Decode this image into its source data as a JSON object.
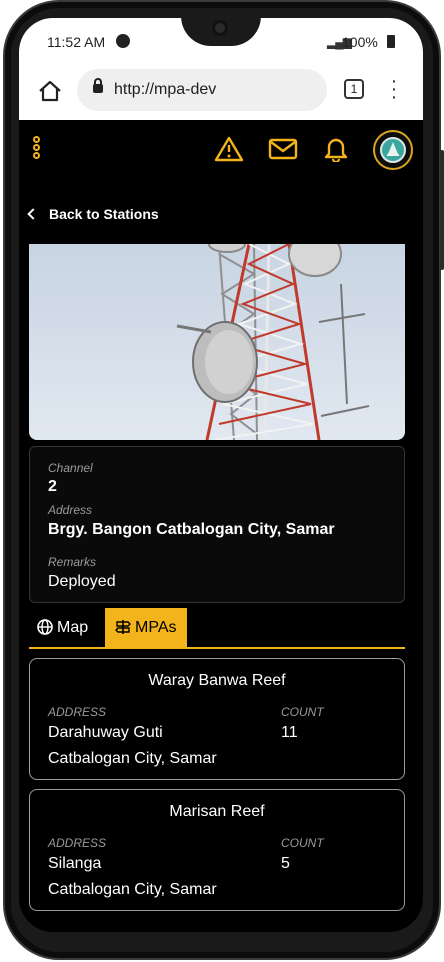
{
  "status_bar": {
    "time": "11:52 AM",
    "battery": "100%"
  },
  "browser": {
    "url": "http://mpa-dev",
    "tab_count": "1"
  },
  "nav": {
    "back_label": "Back to Stations"
  },
  "station": {
    "channel_label": "Channel",
    "channel_value": "2",
    "address_label": "Address",
    "address_value": "Brgy. Bangon Catbalogan City, Samar",
    "remarks_label": "Remarks",
    "remarks_value": "Deployed"
  },
  "tabs": [
    {
      "label": "Map",
      "icon": "globe-icon",
      "active": false
    },
    {
      "label": "MPAs",
      "icon": "signpost-icon",
      "active": true
    }
  ],
  "mpas": [
    {
      "name": "Waray Banwa Reef",
      "address_label": "ADDRESS",
      "count_label": "COUNT",
      "address_line1": "Darahuway Guti",
      "address_line2": "Catbalogan City, Samar",
      "count": "11"
    },
    {
      "name": "Marisan Reef",
      "address_label": "ADDRESS",
      "count_label": "COUNT",
      "address_line1": "Silanga",
      "address_line2": "Catbalogan City, Samar",
      "count": "5"
    }
  ],
  "colors": {
    "accent": "#f3b41b",
    "background": "#000000",
    "card_border": "#9c9c9c"
  }
}
